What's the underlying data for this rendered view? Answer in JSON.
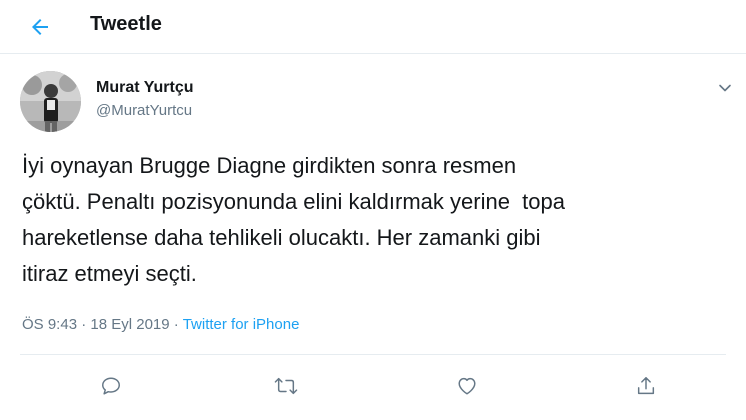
{
  "header": {
    "back_icon": "arrow-left-icon",
    "title": "Tweetle"
  },
  "tweet": {
    "author": {
      "name": "Murat Yurtçu",
      "handle": "@MuratYurtcu"
    },
    "caret_icon": "chevron-down-icon",
    "text_lines": [
      "İyi oynayan Brugge Diagne girdikten sonra resmen",
      "çöktü. Penaltı pozisyonunda elini kaldırmak yerine  topa",
      "hareketlense daha tehlikeli olucaktı. Her zamanki gibi",
      "itiraz etmeyi seçti."
    ],
    "meta": {
      "time": "ÖS 9:43",
      "separator1": " · ",
      "date": "18 Eyl 2019",
      "separator2": " · ",
      "source": "Twitter for iPhone"
    },
    "actions": [
      {
        "icon": "reply-icon"
      },
      {
        "icon": "retweet-icon"
      },
      {
        "icon": "like-icon"
      },
      {
        "icon": "share-icon"
      }
    ]
  },
  "colors": {
    "accent": "#1da1f2",
    "text_primary": "#14171a",
    "text_secondary": "#657786",
    "divider": "#e6ecf0"
  }
}
